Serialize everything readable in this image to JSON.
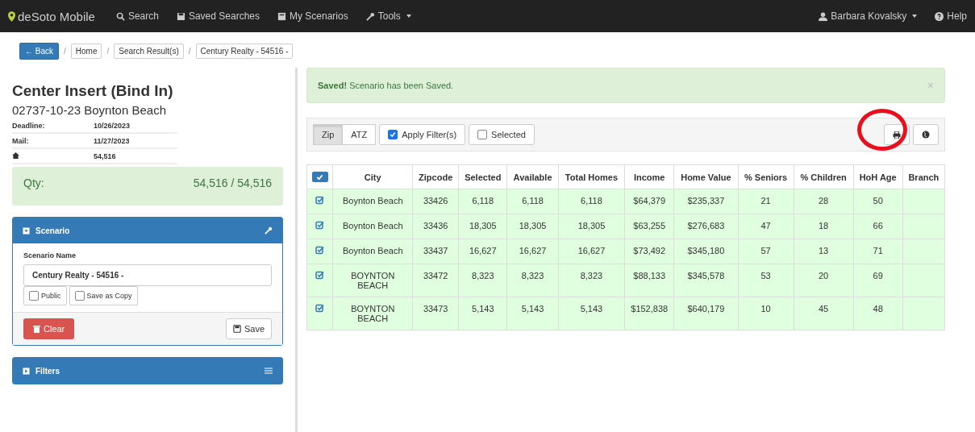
{
  "navbar": {
    "brand": "deSoto Mobile",
    "items": [
      {
        "label": "Search",
        "caret": false
      },
      {
        "label": "Saved Searches",
        "caret": false
      },
      {
        "label": "My Scenarios",
        "caret": false
      },
      {
        "label": "Tools",
        "caret": true
      }
    ],
    "user": "Barbara Kovalsky",
    "help": "Help"
  },
  "breadcrumb": {
    "back": "← Back",
    "items": [
      {
        "separator": "/",
        "label": "Home"
      },
      {
        "separator": "/",
        "label": "Search Result(s)"
      },
      {
        "separator": "/",
        "label": "Century Realty - 54516 -"
      }
    ]
  },
  "job": {
    "title": "Center Insert (Bind In)",
    "subtitle": "02737-10-23 Boynton Beach",
    "details": [
      {
        "label": "Deadline:",
        "value": "10/26/2023"
      },
      {
        "label": "Mail:",
        "value": "11/27/2023"
      },
      {
        "kind": "home",
        "value": "54,516"
      }
    ],
    "qty_label": "Qty:",
    "qty_value": "54,516 / 54,516"
  },
  "scenario_panel": {
    "title": "Scenario",
    "name_label": "Scenario Name",
    "name_value": "Century Realty - 54516 -",
    "options": [
      {
        "label": "Public",
        "checked": false
      },
      {
        "label": "Save as Copy",
        "checked": false
      }
    ],
    "clear": "Clear",
    "save": "Save"
  },
  "filters_panel": {
    "title": "Filters"
  },
  "alert": {
    "strong": "Saved!",
    "text": "Scenario has been Saved.",
    "close": "×"
  },
  "toolbar": {
    "toggle": [
      {
        "label": "Zip",
        "selected": true
      },
      {
        "label": "ATZ",
        "selected": false
      }
    ],
    "checks": [
      {
        "label": "Apply Filter(s)",
        "checked": true
      },
      {
        "label": "Selected",
        "checked": false
      }
    ]
  },
  "table": {
    "header_checked": true,
    "columns": [
      "City",
      "Zipcode",
      "Selected",
      "Available",
      "Total Homes",
      "Income",
      "Home Value",
      "% Seniors",
      "% Children",
      "HoH Age",
      "Branch"
    ],
    "rows": [
      {
        "selected": true,
        "cells": [
          "Boynton Beach",
          "33426",
          "6,118",
          "6,118",
          "6,118",
          "$64,379",
          "$235,337",
          "21",
          "28",
          "50",
          ""
        ]
      },
      {
        "selected": true,
        "cells": [
          "Boynton Beach",
          "33436",
          "18,305",
          "18,305",
          "18,305",
          "$63,255",
          "$276,683",
          "47",
          "18",
          "66",
          ""
        ]
      },
      {
        "selected": true,
        "cells": [
          "Boynton Beach",
          "33437",
          "16,627",
          "16,627",
          "16,627",
          "$73,492",
          "$345,180",
          "57",
          "13",
          "71",
          ""
        ]
      },
      {
        "selected": true,
        "cells": [
          "BOYNTON BEACH",
          "33472",
          "8,323",
          "8,323",
          "8,323",
          "$88,133",
          "$345,578",
          "53",
          "20",
          "69",
          ""
        ]
      },
      {
        "selected": true,
        "cells": [
          "BOYNTON BEACH",
          "33473",
          "5,143",
          "5,143",
          "5,143",
          "$152,838",
          "$640,179",
          "10",
          "45",
          "48",
          ""
        ]
      }
    ]
  }
}
